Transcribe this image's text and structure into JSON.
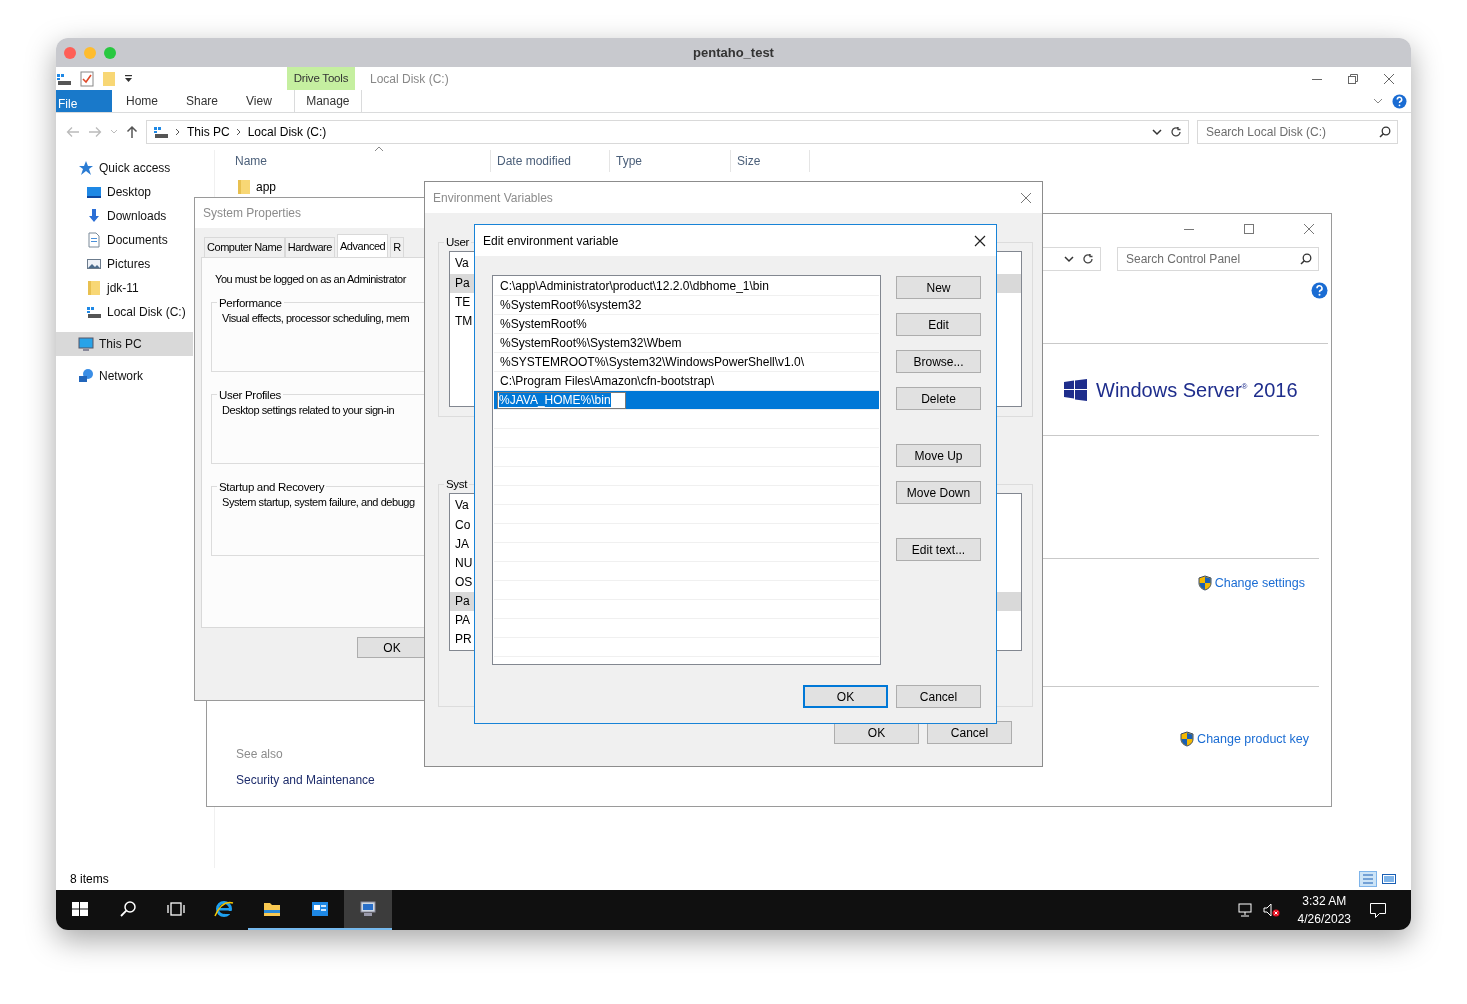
{
  "window": {
    "title": "pentaho_test"
  },
  "explorer": {
    "ribbon": {
      "context_group": "Drive Tools",
      "location_title": "Local Disk (C:)",
      "tabs": [
        {
          "label": "File",
          "kind": "backstage"
        },
        {
          "label": "Home",
          "kind": "tab"
        },
        {
          "label": "Share",
          "kind": "tab"
        },
        {
          "label": "View",
          "kind": "tab"
        },
        {
          "label": "Manage",
          "kind": "context"
        }
      ]
    },
    "breadcrumb": [
      "This PC",
      "Local Disk (C:)"
    ],
    "search": {
      "placeholder": "Search Local Disk (C:)"
    },
    "columns": [
      "Name",
      "Date modified",
      "Type",
      "Size"
    ],
    "files": [
      {
        "name": "app"
      }
    ],
    "nav": [
      {
        "label": "Quick access",
        "kind": "star",
        "selected": false,
        "children": [
          {
            "label": "Desktop",
            "kind": "desktop",
            "selected": false
          },
          {
            "label": "Downloads",
            "kind": "download",
            "selected": false
          },
          {
            "label": "Documents",
            "kind": "document",
            "selected": false
          },
          {
            "label": "Pictures",
            "kind": "picture",
            "selected": false
          },
          {
            "label": "jdk-11",
            "kind": "folder",
            "selected": false
          },
          {
            "label": "Local Disk (C:)",
            "kind": "drive",
            "selected": false
          }
        ]
      },
      {
        "label": "This PC",
        "kind": "pc",
        "selected": true
      },
      {
        "label": "Network",
        "kind": "network",
        "selected": false
      }
    ],
    "status": "8 items"
  },
  "control_panel": {
    "search": {
      "placeholder": "Search Control Panel"
    },
    "logo": "Windows Server$^{®}$ 2016",
    "links": [
      "Change settings",
      "Change product key"
    ],
    "see_also": {
      "heading": "See also",
      "links": [
        "Security and Maintenance"
      ]
    }
  },
  "system_properties": {
    "title": "System Properties",
    "tabs": [
      {
        "label": "Computer Name",
        "selected": false
      },
      {
        "label": "Hardware",
        "selected": false
      },
      {
        "label": "Advanced",
        "selected": true
      },
      {
        "label": "R",
        "selected": false
      }
    ],
    "notice": "You must be logged on as an Administrator",
    "groups": [
      {
        "title": "Performance",
        "text": "Visual effects, processor scheduling, mem"
      },
      {
        "title": "User Profiles",
        "text": "Desktop settings related to your sign-in"
      },
      {
        "title": "Startup and Recovery",
        "text": "System startup, system failure, and debugg"
      }
    ],
    "ok": "OK"
  },
  "environment_variables": {
    "title": "Environment Variables",
    "user": {
      "label": "User",
      "header": "Va",
      "rows": [
        {
          "text": "Pa",
          "selected": true
        },
        {
          "text": "TE",
          "selected": false
        },
        {
          "text": "TM",
          "selected": false
        }
      ]
    },
    "system": {
      "label": "Syst",
      "header": "Va",
      "rows": [
        {
          "text": "Co",
          "selected": false
        },
        {
          "text": "JA",
          "selected": false
        },
        {
          "text": "NU",
          "selected": false
        },
        {
          "text": "OS",
          "selected": false
        },
        {
          "text": "Pa",
          "selected": true
        },
        {
          "text": "PA",
          "selected": false
        },
        {
          "text": "PR",
          "selected": false
        }
      ]
    },
    "ok": "OK",
    "cancel": "Cancel"
  },
  "edit_dialog": {
    "title": "Edit environment variable",
    "entries": [
      {
        "text": "C:\\app\\Administrator\\product\\12.2.0\\dbhome_1\\bin",
        "selected": false,
        "editing": false
      },
      {
        "text": "%SystemRoot%\\system32",
        "selected": false,
        "editing": false
      },
      {
        "text": "%SystemRoot%",
        "selected": false,
        "editing": false
      },
      {
        "text": "%SystemRoot%\\System32\\Wbem",
        "selected": false,
        "editing": false
      },
      {
        "text": "%SYSTEMROOT%\\System32\\WindowsPowerShell\\v1.0\\",
        "selected": false,
        "editing": false
      },
      {
        "text": "C:\\Program Files\\Amazon\\cfn-bootstrap\\",
        "selected": false,
        "editing": false
      },
      {
        "text": "%JAVA_HOME%\\bin",
        "selected": true,
        "editing": true
      }
    ],
    "side_buttons": [
      {
        "label": "New",
        "kind": "top"
      },
      {
        "label": "Edit",
        "kind": "top"
      },
      {
        "label": "Browse...",
        "kind": "top"
      },
      {
        "label": "Delete",
        "kind": "top"
      },
      {
        "label": "Move Up",
        "kind": "gap"
      },
      {
        "label": "Move Down",
        "kind": "top"
      },
      {
        "label": "Edit text...",
        "kind": "gap"
      }
    ],
    "ok": "OK",
    "cancel": "Cancel"
  },
  "taskbar": {
    "apps": [
      {
        "kind": "start",
        "running": false,
        "selected": false
      },
      {
        "kind": "search",
        "running": false,
        "selected": false
      },
      {
        "kind": "taskview",
        "running": false,
        "selected": false
      },
      {
        "kind": "browser",
        "running": false,
        "selected": false
      },
      {
        "kind": "explorer",
        "running": true,
        "selected": false
      },
      {
        "kind": "server",
        "running": true,
        "selected": false
      },
      {
        "kind": "system",
        "running": true,
        "selected": true
      }
    ],
    "volume_muted": true,
    "time": "3:32 AM",
    "date": "4/26/2023"
  }
}
